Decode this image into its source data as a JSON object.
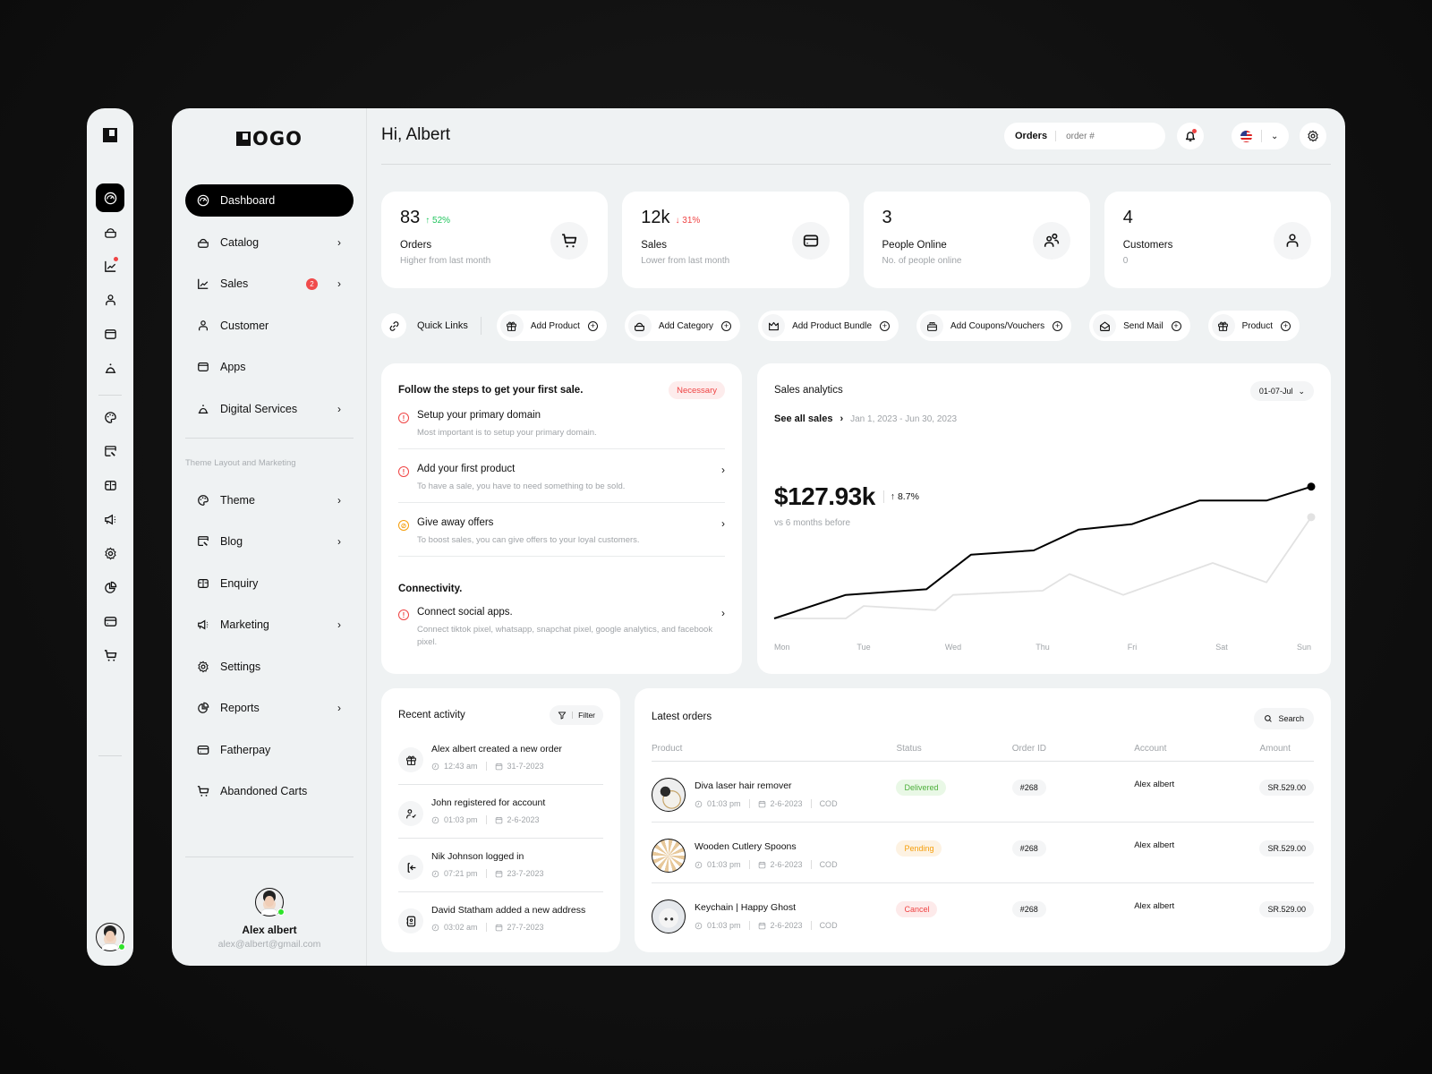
{
  "rail": {
    "items": [
      {
        "icon": "dashboard-icon",
        "active": true
      },
      {
        "icon": "catalog-icon"
      },
      {
        "icon": "sales-icon",
        "dot": true
      },
      {
        "icon": "customer-icon"
      },
      {
        "icon": "apps-icon"
      },
      {
        "icon": "digital-services-icon"
      },
      {
        "icon": "theme-icon"
      },
      {
        "icon": "blog-icon"
      },
      {
        "icon": "enquiry-icon"
      },
      {
        "icon": "marketing-icon"
      },
      {
        "icon": "settings-icon"
      },
      {
        "icon": "reports-icon"
      },
      {
        "icon": "fatherpay-icon"
      },
      {
        "icon": "abandoned-carts-icon"
      }
    ]
  },
  "brand": {
    "logo_text": "OGO"
  },
  "sidebar": {
    "items": [
      {
        "label": "Dashboard",
        "icon": "dashboard-icon",
        "active": true
      },
      {
        "label": "Catalog",
        "icon": "catalog-icon",
        "chevron": true
      },
      {
        "label": "Sales",
        "icon": "sales-icon",
        "chevron": true,
        "badge": "2"
      },
      {
        "label": "Customer",
        "icon": "customer-icon"
      },
      {
        "label": "Apps",
        "icon": "apps-icon"
      },
      {
        "label": "Digital Services",
        "icon": "digital-services-icon",
        "chevron": true
      }
    ],
    "section_caption": "Theme Layout and Marketing",
    "items2": [
      {
        "label": "Theme",
        "icon": "theme-icon",
        "chevron": true
      },
      {
        "label": "Blog",
        "icon": "blog-icon",
        "chevron": true
      },
      {
        "label": "Enquiry",
        "icon": "enquiry-icon"
      },
      {
        "label": "Marketing",
        "icon": "marketing-icon",
        "chevron": true
      },
      {
        "label": "Settings",
        "icon": "settings-icon"
      },
      {
        "label": "Reports",
        "icon": "reports-icon",
        "chevron": true
      },
      {
        "label": "Fatherpay",
        "icon": "fatherpay-icon"
      },
      {
        "label": "Abandoned Carts",
        "icon": "abandoned-carts-icon"
      }
    ],
    "profile": {
      "name": "Alex albert",
      "email": "alex@albert@gmail.com",
      "online": true
    }
  },
  "header": {
    "greeting": "Hi, Albert",
    "order_search_label": "Orders",
    "order_search_placeholder": "order #",
    "notification_dot": true,
    "language": "en-US"
  },
  "stats": [
    {
      "value": "83",
      "change": "52%",
      "direction": "up",
      "label": "Orders",
      "sub": "Higher from last month",
      "icon": "cart-icon"
    },
    {
      "value": "12k",
      "change": "31%",
      "direction": "down",
      "label": "Sales",
      "sub": "Lower from last month",
      "icon": "card-icon"
    },
    {
      "value": "3",
      "change": "",
      "direction": "",
      "label": "People Online",
      "sub": "No. of people online",
      "icon": "users-icon"
    },
    {
      "value": "4",
      "change": "",
      "direction": "",
      "label": "Customers",
      "sub": "0",
      "icon": "user-icon"
    }
  ],
  "quick_links": {
    "title": "Quick Links",
    "items": [
      {
        "label": "Add Product",
        "icon": "gift-box-icon"
      },
      {
        "label": "Add Category",
        "icon": "basket-icon"
      },
      {
        "label": "Add Product Bundle",
        "icon": "crown-icon"
      },
      {
        "label": "Add Coupons/Vouchers",
        "icon": "coupon-icon"
      },
      {
        "label": "Send Mail",
        "icon": "mail-open-icon"
      },
      {
        "label": "Product",
        "icon": "gift-box-icon"
      }
    ]
  },
  "steps": {
    "title": "Follow the steps to get your first sale.",
    "badge": "Necessary",
    "items": [
      {
        "title": "Setup your primary domain",
        "desc": "Most important is to setup your primary domain.",
        "status": "alert",
        "chevron": false
      },
      {
        "title": "Add your first product",
        "desc": "To have a sale, you have to need something to be sold.",
        "status": "alert",
        "chevron": true
      },
      {
        "title": "Give away offers",
        "desc": "To boost sales, you can give offers to your loyal customers.",
        "status": "pending",
        "chevron": true
      }
    ],
    "connectivity_title": "Connectivity.",
    "connectivity": [
      {
        "title": "Connect social apps.",
        "desc": "Connect tiktok pixel, whatsapp, snapchat pixel, google analytics, and facebook pixel.",
        "status": "alert",
        "chevron": true
      }
    ]
  },
  "analytics": {
    "title": "Sales analytics",
    "range_select": "01-07-Jul",
    "see_all": "See all sales",
    "date_range": "Jan 1, 2023 - Jun 30, 2023",
    "total": "$127.93k",
    "change": "8.7%",
    "compare_text": "vs 6 months before"
  },
  "chart_data": {
    "type": "line",
    "title": "Sales analytics",
    "x": [
      "Mon",
      "Tue",
      "Wed",
      "Thu",
      "Fri",
      "Sat",
      "Sun"
    ],
    "x_positions": [
      0,
      0.5,
      1,
      1.5,
      2,
      2.5,
      3,
      3.5,
      4,
      4.5,
      5,
      5.5,
      6
    ],
    "series": [
      {
        "name": "Current period",
        "color": "#000000",
        "points": [
          [
            0,
            0
          ],
          [
            0.8,
            17
          ],
          [
            1.7,
            21
          ],
          [
            2.2,
            46
          ],
          [
            2.9,
            49
          ],
          [
            3.4,
            64
          ],
          [
            4.0,
            68
          ],
          [
            4.75,
            85
          ],
          [
            5.5,
            85
          ],
          [
            6,
            95
          ]
        ]
      },
      {
        "name": "Previous period",
        "color": "#e2e2e2",
        "points": [
          [
            0,
            0
          ],
          [
            0.8,
            0
          ],
          [
            1.0,
            9
          ],
          [
            1.8,
            6
          ],
          [
            2.0,
            17
          ],
          [
            3.0,
            20
          ],
          [
            3.3,
            32
          ],
          [
            3.9,
            17
          ],
          [
            4.9,
            40
          ],
          [
            5.5,
            26
          ],
          [
            6,
            73
          ]
        ]
      }
    ],
    "ylim": [
      0,
      100
    ],
    "grid": false,
    "legend": "none",
    "xlabel": "",
    "ylabel": ""
  },
  "activity": {
    "title": "Recent activity",
    "filter_label": "Filter",
    "items": [
      {
        "text": "Alex albert created a new order",
        "time": "12:43 am",
        "date": "31-7-2023",
        "icon": "gift-box-icon"
      },
      {
        "text": "John registered for account",
        "time": "01:03 pm",
        "date": "2-6-2023",
        "icon": "user-check-icon"
      },
      {
        "text": "Nik Johnson logged in",
        "time": "07:21 pm",
        "date": "23-7-2023",
        "icon": "login-icon"
      },
      {
        "text": "David Statham added a new address",
        "time": "03:02 am",
        "date": "27-7-2023",
        "icon": "address-book-icon"
      }
    ]
  },
  "orders": {
    "title": "Latest orders",
    "search_label": "Search",
    "columns": [
      "Product",
      "Status",
      "Order ID",
      "Account",
      "Amount"
    ],
    "rows": [
      {
        "product": "Diva laser hair remover",
        "time": "01:03 pm",
        "date": "2-6-2023",
        "payment": "COD",
        "status": "Delivered",
        "status_key": "delivered",
        "order_id": "#268",
        "account": "Alex albert",
        "amount": "SR.529.00",
        "thumb": "laser"
      },
      {
        "product": "Wooden Cutlery Spoons",
        "time": "01:03 pm",
        "date": "2-6-2023",
        "payment": "COD",
        "status": "Pending",
        "status_key": "pending",
        "order_id": "#268",
        "account": "Alex albert",
        "amount": "SR.529.00",
        "thumb": "spoons"
      },
      {
        "product": "Keychain | Happy Ghost",
        "time": "01:03 pm",
        "date": "2-6-2023",
        "payment": "COD",
        "status": "Cancel",
        "status_key": "cancel",
        "order_id": "#268",
        "account": "Alex albert",
        "amount": "SR.529.00",
        "thumb": "ghost"
      }
    ]
  }
}
